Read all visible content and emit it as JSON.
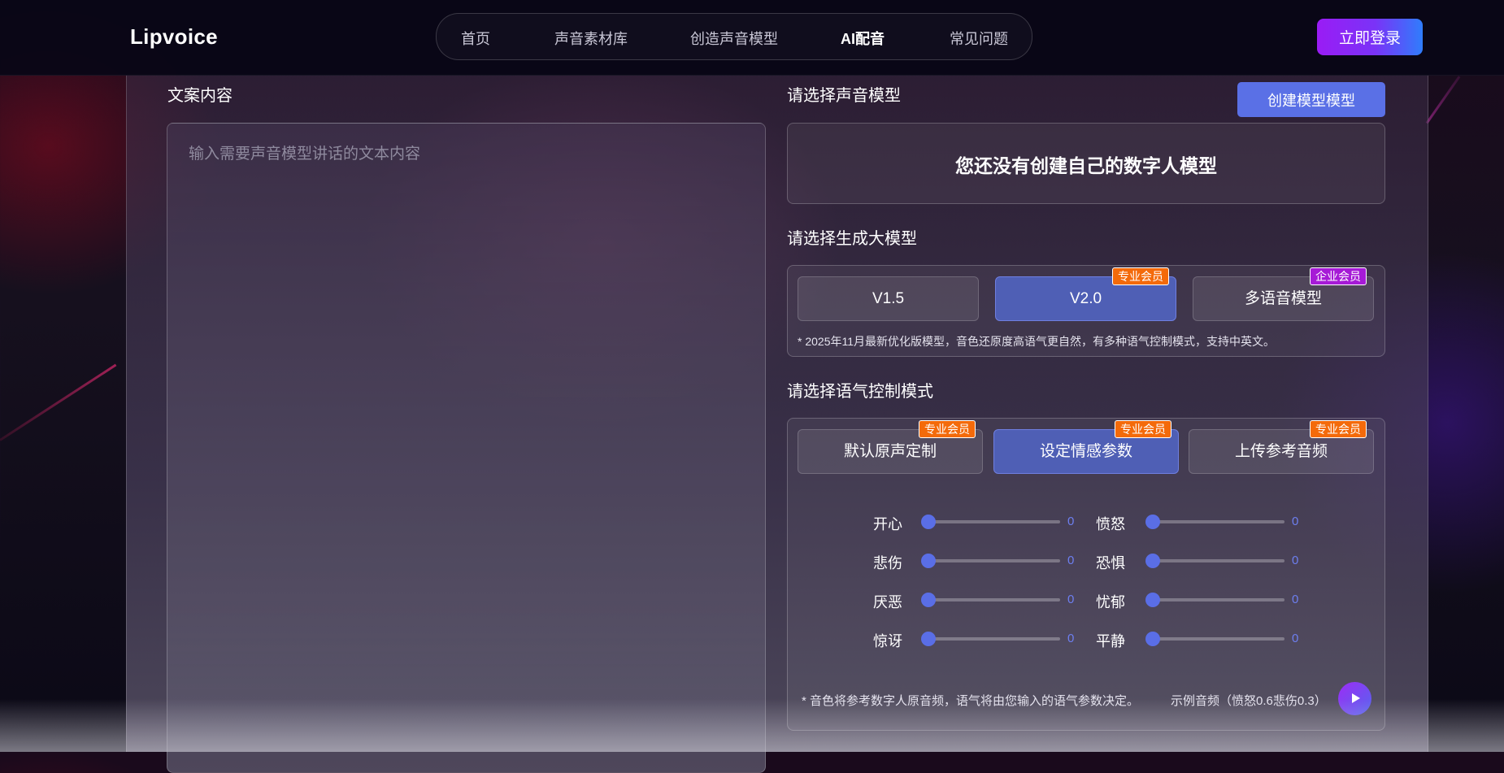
{
  "header": {
    "logo": "Lipvoice",
    "nav": [
      "首页",
      "声音素材库",
      "创造声音模型",
      "AI配音",
      "常见问题"
    ],
    "active_nav": "AI配音",
    "login_label": "立即登录"
  },
  "left": {
    "title": "文案内容",
    "placeholder": "输入需要声音模型讲话的文本内容"
  },
  "voice_model": {
    "title": "请选择声音模型",
    "create_label": "创建模型模型",
    "empty_text": "您还没有创建自己的数字人模型"
  },
  "gen_model": {
    "title": "请选择生成大模型",
    "options": [
      {
        "label": "V1.5",
        "badge": ""
      },
      {
        "label": "V2.0",
        "badge": "专业会员"
      },
      {
        "label": "多语音模型",
        "badge": "企业会员"
      }
    ],
    "selected": "V2.0",
    "note": "* 2025年11月最新优化版模型，音色还原度高语气更自然，有多种语气控制模式，支持中英文。"
  },
  "tone_mode": {
    "title": "请选择语气控制模式",
    "options": [
      {
        "label": "默认原声定制",
        "badge": "专业会员"
      },
      {
        "label": "设定情感参数",
        "badge": "专业会员"
      },
      {
        "label": "上传参考音频",
        "badge": "专业会员"
      }
    ],
    "selected": "设定情感参数",
    "emotions": [
      {
        "label": "开心",
        "value": 0
      },
      {
        "label": "愤怒",
        "value": 0
      },
      {
        "label": "悲伤",
        "value": 0
      },
      {
        "label": "恐惧",
        "value": 0
      },
      {
        "label": "厌恶",
        "value": 0
      },
      {
        "label": "忧郁",
        "value": 0
      },
      {
        "label": "惊讶",
        "value": 0
      },
      {
        "label": "平静",
        "value": 0
      }
    ],
    "note": "* 音色将参考数字人原音频，语气将由您输入的语气参数决定。",
    "sample_label": "示例音频（愤怒0.6悲伤0.3）"
  },
  "colors": {
    "accent": "#5a70e6",
    "selected_option": "#4f5fb5",
    "badge_pro": "#f46a0a",
    "badge_enterprise": "#a61ad6",
    "login_gradient": [
      "#9a1cf5",
      "#2f7dfc"
    ]
  },
  "icons": {
    "play": "play-icon"
  }
}
